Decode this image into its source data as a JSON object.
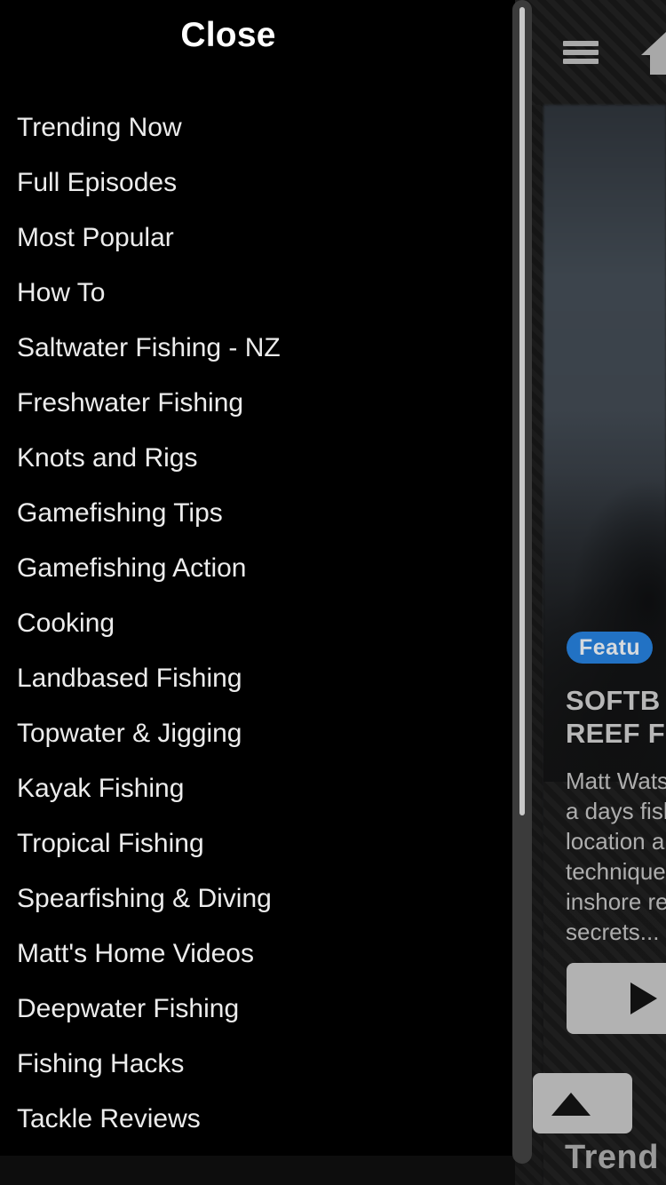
{
  "app": {
    "header": {
      "menu_icon": "hamburger-icon",
      "home_icon": "home-icon"
    },
    "featured": {
      "badge": "Featu",
      "title_line1": "SOFTB",
      "title_line2": "REEF F",
      "description_lines": [
        "Matt Wats",
        "a days fish",
        "location a",
        "technique",
        "inshore re",
        "secrets..."
      ],
      "play_icon": "play-icon",
      "scroll_top_icon": "triangle-up-icon"
    },
    "section_heading": "Trend"
  },
  "drawer": {
    "close_label": "Close",
    "items": [
      {
        "label": "Trending Now"
      },
      {
        "label": "Full Episodes"
      },
      {
        "label": "Most Popular"
      },
      {
        "label": "How To"
      },
      {
        "label": "Saltwater Fishing - NZ"
      },
      {
        "label": "Freshwater Fishing"
      },
      {
        "label": "Knots and Rigs"
      },
      {
        "label": "Gamefishing Tips"
      },
      {
        "label": "Gamefishing Action"
      },
      {
        "label": "Cooking"
      },
      {
        "label": "Landbased Fishing"
      },
      {
        "label": "Topwater & Jigging"
      },
      {
        "label": "Kayak Fishing"
      },
      {
        "label": "Tropical Fishing"
      },
      {
        "label": "Spearfishing & Diving"
      },
      {
        "label": "Matt's Home Videos"
      },
      {
        "label": "Deepwater Fishing"
      },
      {
        "label": "Fishing Hacks"
      },
      {
        "label": "Tackle Reviews"
      }
    ],
    "scrollbar": {
      "name": "vertical-scrollbar"
    }
  },
  "colors": {
    "background": "#000000",
    "text": "#ececec",
    "accent_badge": "#2272c4",
    "button": "#b2b2b2",
    "scrollbar_track": "#3b3b3b",
    "scrollbar_thumb": "#c9c9c9"
  }
}
